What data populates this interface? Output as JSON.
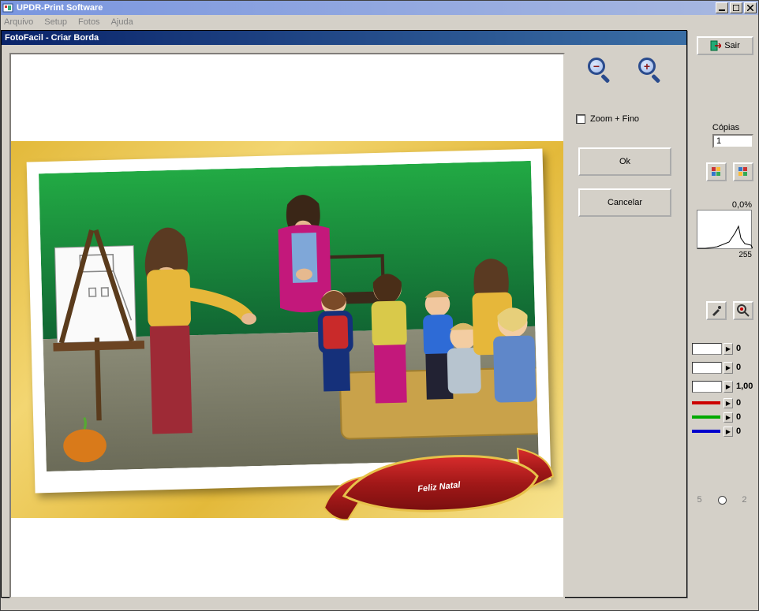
{
  "app": {
    "title": "UPDR-Print Software",
    "menu": [
      "Arquivo",
      "Setup",
      "Fotos",
      "Ajuda"
    ],
    "exit_label": "Sair"
  },
  "side": {
    "copias_label": "Cópias",
    "copias_value": "1",
    "pct": "0,0%",
    "histo_max": "255",
    "sliders": {
      "v1": "0",
      "v2": "0",
      "v3": "1,00",
      "r": "0",
      "g": "0",
      "b": "0"
    },
    "radios": {
      "a": "5",
      "b": "2"
    }
  },
  "dialog": {
    "title": "FotoFacil - Criar Borda",
    "zoom_fino": "Zoom + Fino",
    "ok": "Ok",
    "cancel": "Cancelar",
    "banner_text": "Feliz Natal"
  }
}
